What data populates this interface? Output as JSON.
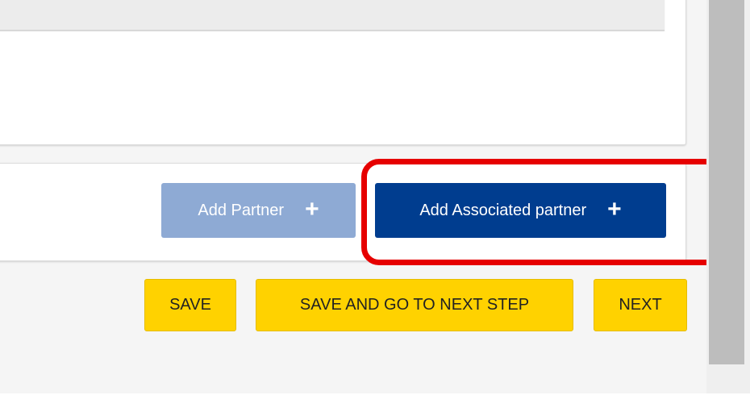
{
  "partners_actions": {
    "add_partner_label": "Add Partner",
    "add_associated_label": "Add Associated partner",
    "plus_icon": "plus-icon"
  },
  "footer_actions": {
    "save_label": "SAVE",
    "save_next_label": "SAVE AND GO TO NEXT STEP",
    "next_label": "NEXT"
  },
  "colors": {
    "primary_blue": "#003d8f",
    "disabled_blue": "#8eaad4",
    "action_yellow": "#ffd200",
    "highlight_red": "#e60000"
  }
}
